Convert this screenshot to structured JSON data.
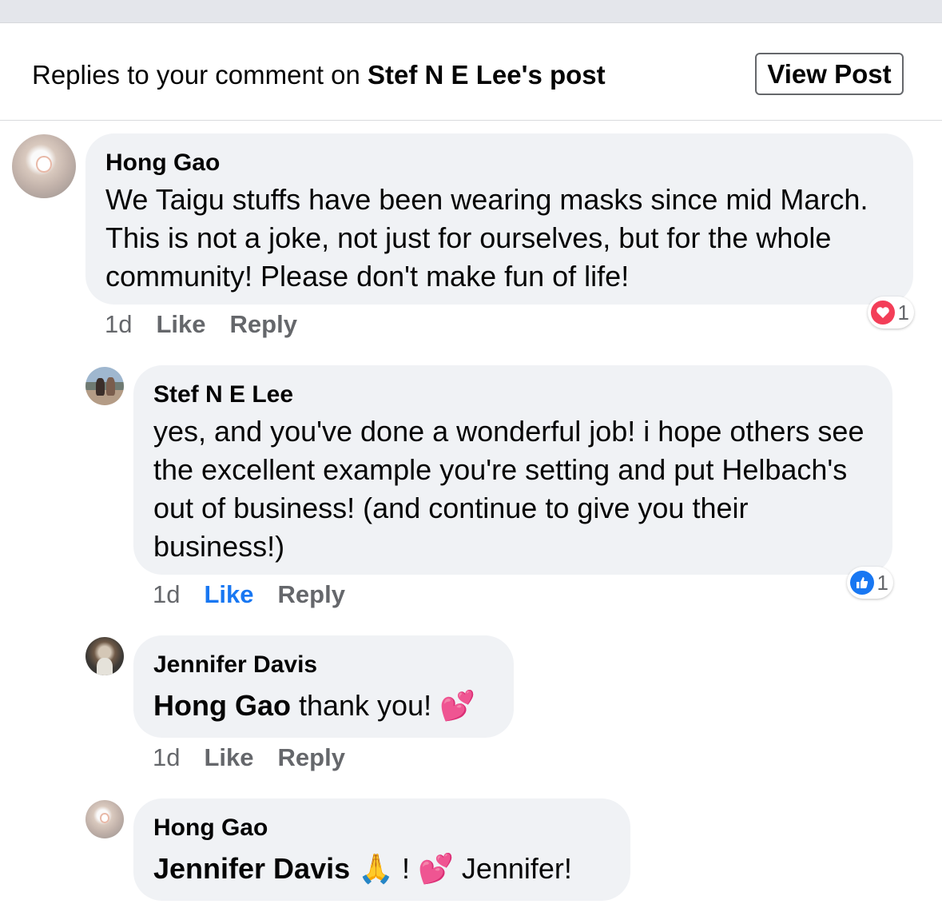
{
  "header": {
    "prefix": "Replies to your comment on ",
    "post_owner": "Stef N E Lee",
    "suffix": "'s post",
    "view_post_label": "View Post"
  },
  "comments": [
    {
      "author": "Hong Gao",
      "text": "We Taigu stuffs have been wearing masks  since mid March. This is not a joke, not just for ourselves, but for the whole community! Please don't make fun of life!",
      "time": "1d",
      "like_label": "Like",
      "reply_label": "Reply",
      "reaction_type": "love",
      "reaction_count": "1"
    },
    {
      "author": "Stef N E Lee",
      "text": "yes, and you've done a wonderful job! i hope others see the excellent example you're setting and put Helbach's out of business! (and continue to give you their business!)",
      "time": "1d",
      "like_label": "Like",
      "reply_label": "Reply",
      "liked": true,
      "reaction_type": "like",
      "reaction_count": "1"
    },
    {
      "author": "Jennifer Davis",
      "mention": "Hong Gao",
      "text": " thank you! ",
      "emoji": "💕",
      "time": "1d",
      "like_label": "Like",
      "reply_label": "Reply"
    },
    {
      "author": "Hong Gao",
      "mention": "Jennifer Davis",
      "emoji_pray": "🙏",
      "text_mid": " !  ",
      "emoji_hearts": "💕",
      "text_end": " Jennifer!"
    }
  ],
  "colors": {
    "bubble": "#f0f2f5",
    "meta": "#65676b",
    "like_blue": "#1877f2",
    "love_red": "#f33e58"
  }
}
